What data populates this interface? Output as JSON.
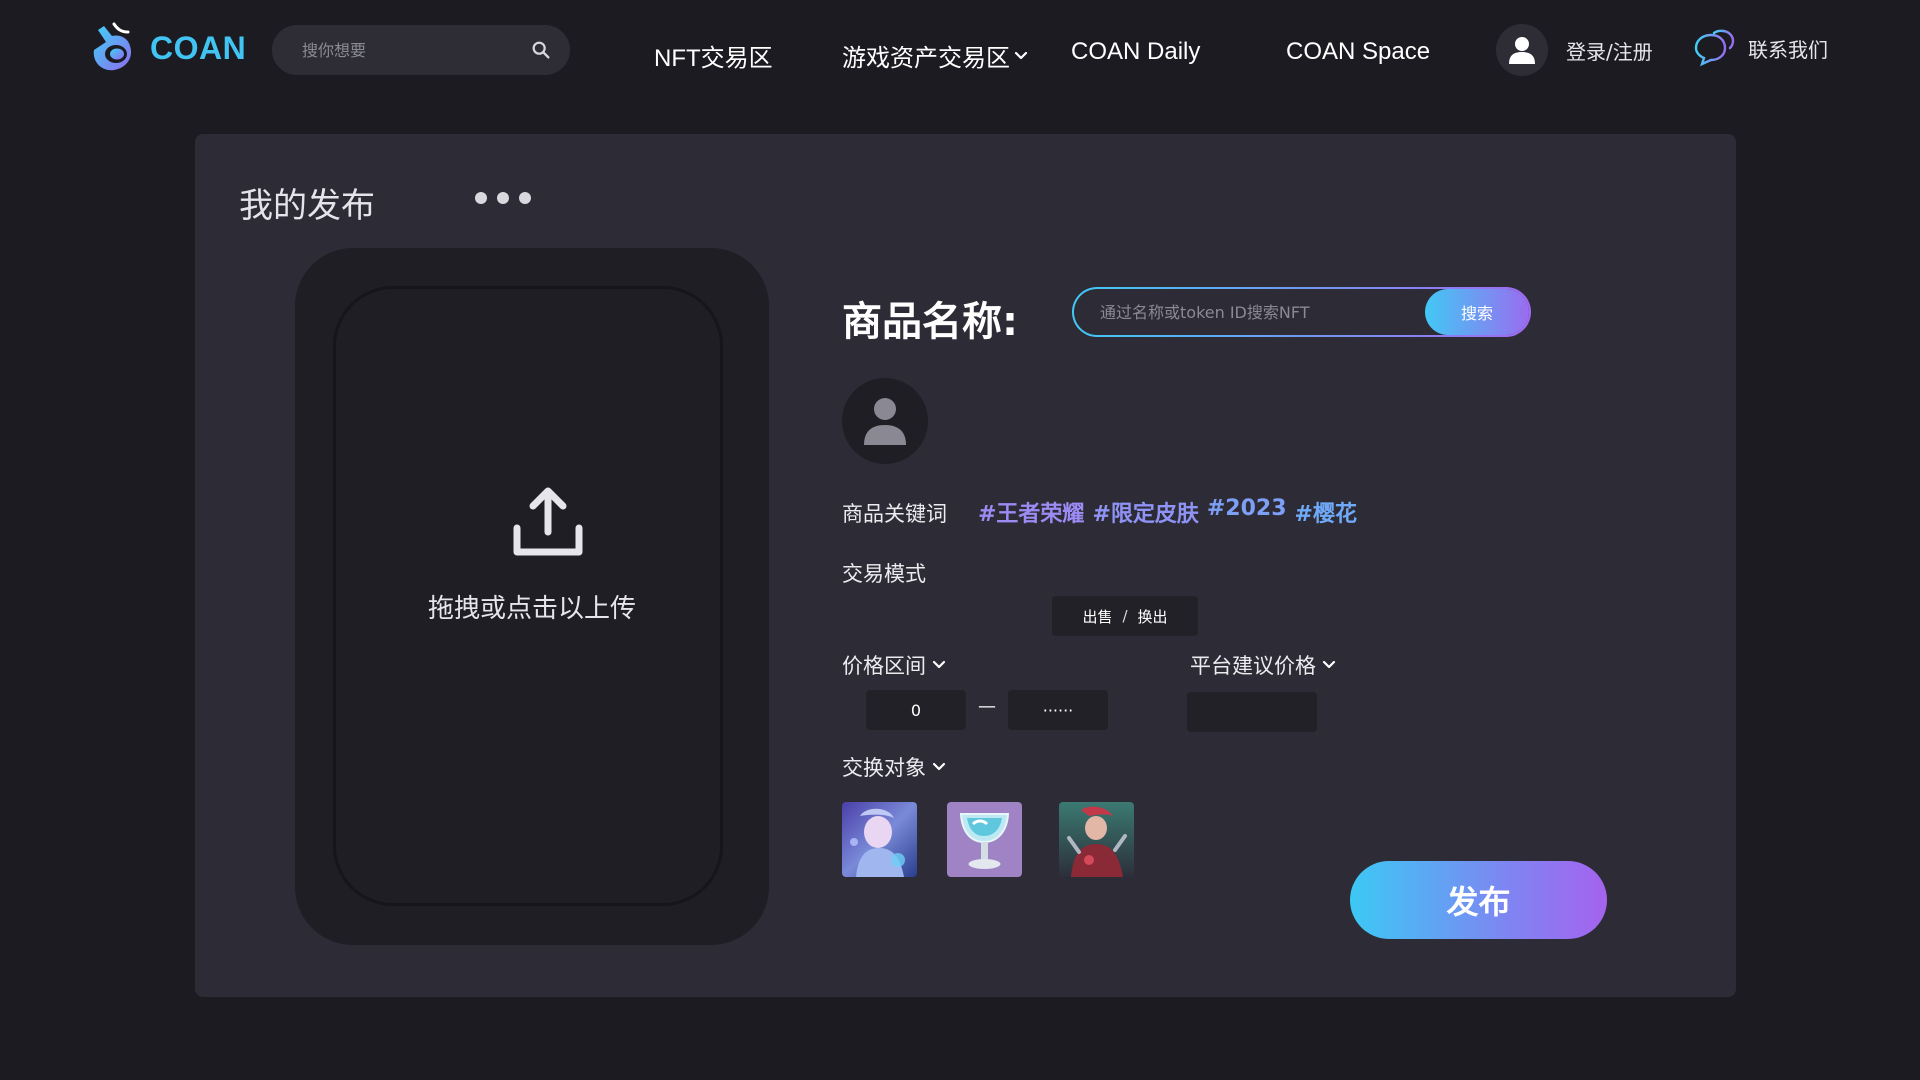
{
  "header": {
    "logo_text": "COAN",
    "search_placeholder": "搜你想要",
    "nav": [
      {
        "label": "NFT交易区"
      },
      {
        "label": "游戏资产交易区"
      },
      {
        "label": "COAN Daily"
      },
      {
        "label": "COAN Space"
      }
    ],
    "login_label": "登录/注册",
    "contact_label": "联系我们"
  },
  "panel": {
    "title": "我的发布",
    "upload_label": "拖拽或点击以上传",
    "product_name_label": "商品名称:",
    "nft_search_placeholder": "通过名称或token ID搜索NFT",
    "nft_search_button": "搜索",
    "keywords_label": "商品关键词",
    "keywords": [
      "#王者荣耀",
      "#限定皮肤",
      "#2023",
      "#樱花"
    ],
    "trade_mode_label": "交易模式",
    "trade_mode": {
      "sell": "出售",
      "separator": "/",
      "exchange": "换出"
    },
    "price_range_label": "价格区间",
    "price_min": "0",
    "price_max": "······",
    "suggested_price_label": "平台建议价格",
    "suggested_price_value": "",
    "exchange_target_label": "交换对象",
    "publish_button": "发布"
  },
  "icons": [
    "coan-logo-icon",
    "search-icon",
    "chevron-down-icon",
    "user-icon",
    "chat-bubbles-icon",
    "more-icon",
    "upload-icon"
  ],
  "colors": {
    "background": "#1c1b22",
    "panel": "#2d2b35",
    "accent_start": "#3cc9f4",
    "accent_end": "#a563ee",
    "logo": "#42c4f2"
  }
}
